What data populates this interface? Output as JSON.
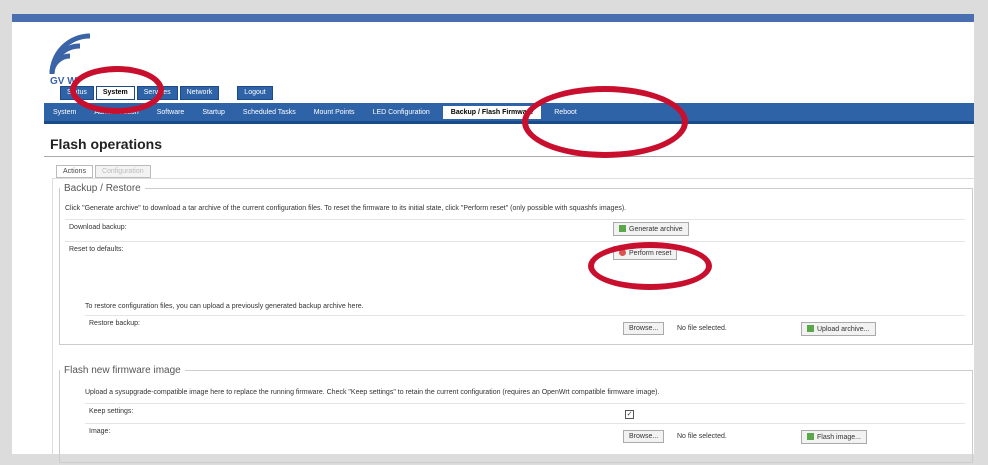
{
  "logo": {
    "text": "GV W"
  },
  "primary_tabs": [
    "Status",
    "System",
    "Services",
    "Network",
    "Logout"
  ],
  "primary_active": "System",
  "secondary_nav": [
    "System",
    "Administration",
    "Software",
    "Startup",
    "Scheduled Tasks",
    "Mount Points",
    "LED Configuration",
    "Backup / Flash Firmware",
    "Reboot"
  ],
  "secondary_active": "Backup / Flash Firmware",
  "page_title": "Flash operations",
  "subtabs": [
    "Actions",
    "Configuration"
  ],
  "backup": {
    "legend": "Backup / Restore",
    "description": "Click \"Generate archive\" to download a tar archive of the current configuration files. To reset the firmware to its initial state, click \"Perform reset\" (only possible with squashfs images).",
    "download_label": "Download backup:",
    "generate_button": "Generate archive",
    "reset_label": "Reset to defaults:",
    "reset_button": "Perform reset",
    "restore_description": "To restore configuration files, you can upload a previously generated backup archive here.",
    "restore_label": "Restore backup:",
    "browse_button": "Browse...",
    "file_status": "No file selected.",
    "upload_button": "Upload archive..."
  },
  "flash": {
    "legend": "Flash new firmware image",
    "description": "Upload a sysupgrade-compatible image here to replace the running firmware. Check \"Keep settings\" to retain the current configuration (requires an OpenWrt compatible firmware image).",
    "keep_label": "Keep settings:",
    "keep_checked": true,
    "image_label": "Image:",
    "browse_button": "Browse...",
    "file_status": "No file selected.",
    "flash_button": "Flash image..."
  },
  "highlight_color": "#c8102e"
}
